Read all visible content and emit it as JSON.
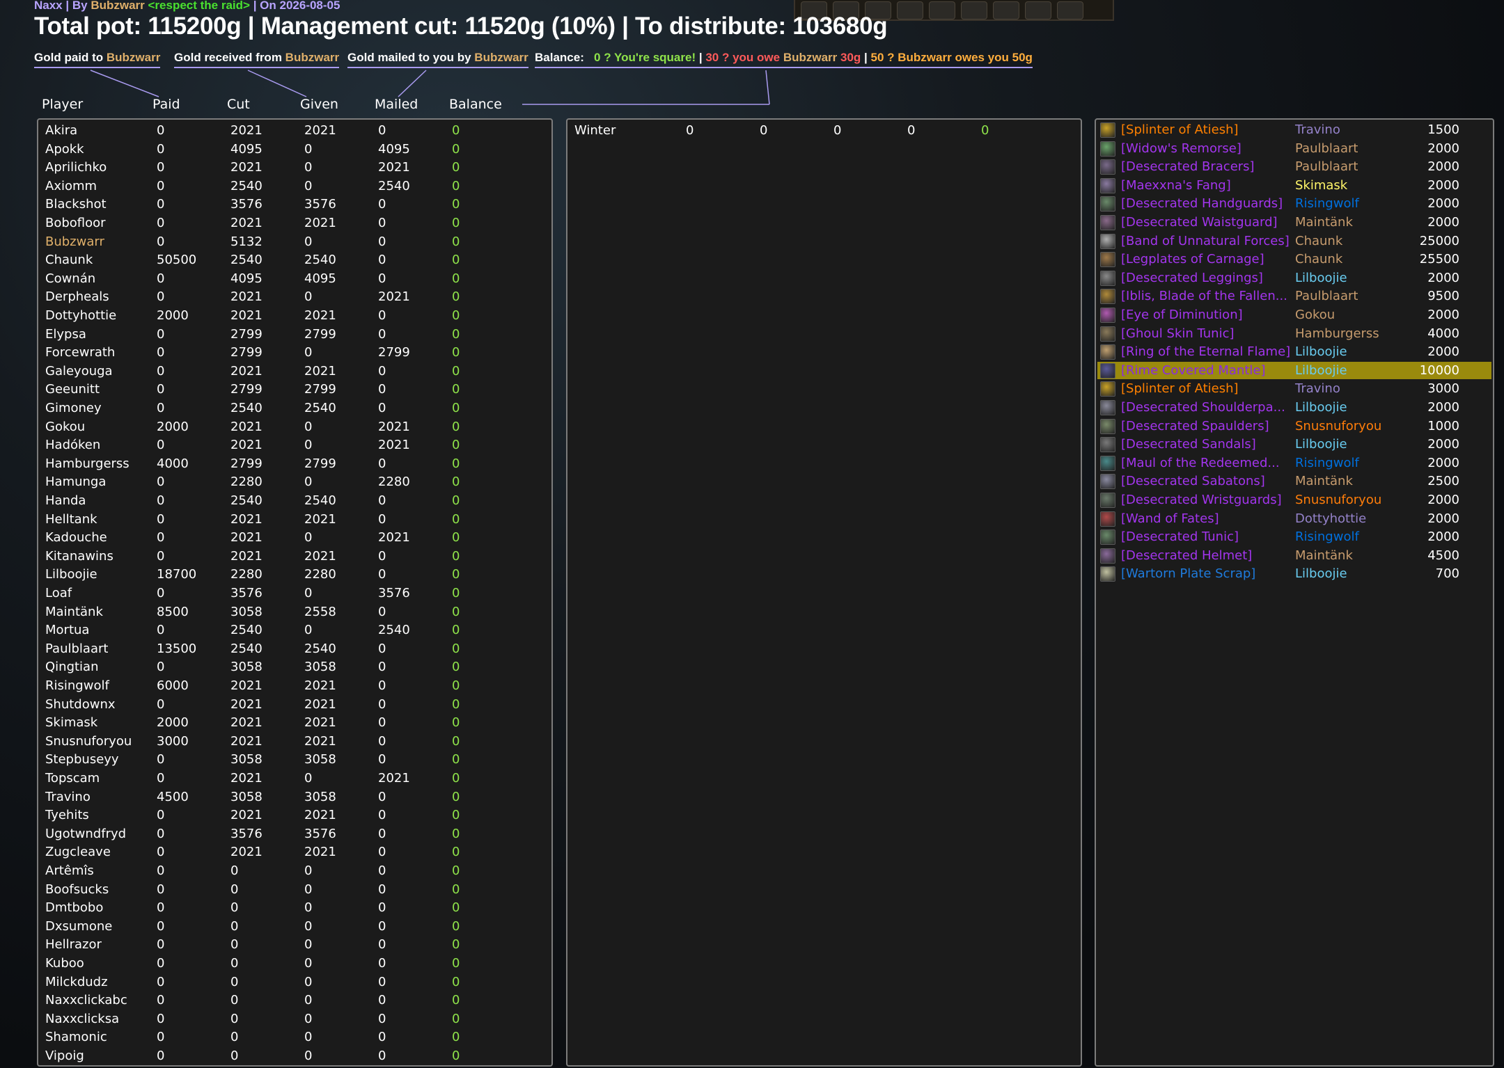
{
  "raid_info": {
    "raid": "Naxx",
    "sep1": " | By ",
    "leader": "Bubzwarr",
    "guild": " <respect the raid>",
    "date_text": " | On 2026-08-05"
  },
  "headline": "Total pot: 115200g | Management cut: 11520g (10%) | To distribute: 103680g",
  "legend": {
    "paid_prefix": "Gold paid to ",
    "paid_name": "Bubzwarr",
    "received_prefix": "Gold received from ",
    "received_name": "Bubzwarr",
    "mailed_prefix": "Gold mailed to you by ",
    "mailed_name": "Bubzwarr",
    "balance_label": "Balance:",
    "balance_square": "0 ? You're square!",
    "sep": " | ",
    "balance_owe_text": "30 ? you owe ",
    "balance_owe_name": "Bubzwarr",
    "balance_owe_amount": " 30g",
    "balance_owes_text": "50 ? ",
    "balance_owes_name": "Bubzwarr",
    "balance_owes_rest": " owes you 50g"
  },
  "columns": {
    "player": "Player",
    "paid": "Paid",
    "cut": "Cut",
    "given": "Given",
    "mailed": "Mailed",
    "balance": "Balance"
  },
  "colors": {
    "balance_zero": "#8fe34a",
    "leader": "#e0b06a",
    "highlight_row": "#9a8a0d"
  },
  "players": [
    {
      "name": "Akira",
      "paid": "0",
      "cut": "2021",
      "given": "2021",
      "mailed": "0",
      "balance": "0"
    },
    {
      "name": "Apokk",
      "paid": "0",
      "cut": "4095",
      "given": "0",
      "mailed": "4095",
      "balance": "0"
    },
    {
      "name": "Aprilichko",
      "paid": "0",
      "cut": "2021",
      "given": "0",
      "mailed": "2021",
      "balance": "0"
    },
    {
      "name": "Axiomm",
      "paid": "0",
      "cut": "2540",
      "given": "0",
      "mailed": "2540",
      "balance": "0"
    },
    {
      "name": "Blackshot",
      "paid": "0",
      "cut": "3576",
      "given": "3576",
      "mailed": "0",
      "balance": "0"
    },
    {
      "name": "Bobofloor",
      "paid": "0",
      "cut": "2021",
      "given": "2021",
      "mailed": "0",
      "balance": "0"
    },
    {
      "name": "Bubzwarr",
      "paid": "0",
      "cut": "5132",
      "given": "0",
      "mailed": "0",
      "balance": "0",
      "leader": true
    },
    {
      "name": "Chaunk",
      "paid": "50500",
      "cut": "2540",
      "given": "2540",
      "mailed": "0",
      "balance": "0"
    },
    {
      "name": "Cownán",
      "paid": "0",
      "cut": "4095",
      "given": "4095",
      "mailed": "0",
      "balance": "0"
    },
    {
      "name": "Derpheals",
      "paid": "0",
      "cut": "2021",
      "given": "0",
      "mailed": "2021",
      "balance": "0"
    },
    {
      "name": "Dottyhottie",
      "paid": "2000",
      "cut": "2021",
      "given": "2021",
      "mailed": "0",
      "balance": "0"
    },
    {
      "name": "Elypsa",
      "paid": "0",
      "cut": "2799",
      "given": "2799",
      "mailed": "0",
      "balance": "0"
    },
    {
      "name": "Forcewrath",
      "paid": "0",
      "cut": "2799",
      "given": "0",
      "mailed": "2799",
      "balance": "0"
    },
    {
      "name": "Galeyouga",
      "paid": "0",
      "cut": "2021",
      "given": "2021",
      "mailed": "0",
      "balance": "0"
    },
    {
      "name": "Geeunitt",
      "paid": "0",
      "cut": "2799",
      "given": "2799",
      "mailed": "0",
      "balance": "0"
    },
    {
      "name": "Gimoney",
      "paid": "0",
      "cut": "2540",
      "given": "2540",
      "mailed": "0",
      "balance": "0"
    },
    {
      "name": "Gokou",
      "paid": "2000",
      "cut": "2021",
      "given": "0",
      "mailed": "2021",
      "balance": "0"
    },
    {
      "name": "Hadóken",
      "paid": "0",
      "cut": "2021",
      "given": "0",
      "mailed": "2021",
      "balance": "0"
    },
    {
      "name": "Hamburgerss",
      "paid": "4000",
      "cut": "2799",
      "given": "2799",
      "mailed": "0",
      "balance": "0"
    },
    {
      "name": "Hamunga",
      "paid": "0",
      "cut": "2280",
      "given": "0",
      "mailed": "2280",
      "balance": "0"
    },
    {
      "name": "Handa",
      "paid": "0",
      "cut": "2540",
      "given": "2540",
      "mailed": "0",
      "balance": "0"
    },
    {
      "name": "Helltank",
      "paid": "0",
      "cut": "2021",
      "given": "2021",
      "mailed": "0",
      "balance": "0"
    },
    {
      "name": "Kadouche",
      "paid": "0",
      "cut": "2021",
      "given": "0",
      "mailed": "2021",
      "balance": "0"
    },
    {
      "name": "Kitanawins",
      "paid": "0",
      "cut": "2021",
      "given": "2021",
      "mailed": "0",
      "balance": "0"
    },
    {
      "name": "Lilboojie",
      "paid": "18700",
      "cut": "2280",
      "given": "2280",
      "mailed": "0",
      "balance": "0"
    },
    {
      "name": "Loaf",
      "paid": "0",
      "cut": "3576",
      "given": "0",
      "mailed": "3576",
      "balance": "0"
    },
    {
      "name": "Maintänk",
      "paid": "8500",
      "cut": "3058",
      "given": "2558",
      "mailed": "0",
      "balance": "0"
    },
    {
      "name": "Mortua",
      "paid": "0",
      "cut": "2540",
      "given": "0",
      "mailed": "2540",
      "balance": "0"
    },
    {
      "name": "Paulblaart",
      "paid": "13500",
      "cut": "2540",
      "given": "2540",
      "mailed": "0",
      "balance": "0"
    },
    {
      "name": "Qingtian",
      "paid": "0",
      "cut": "3058",
      "given": "3058",
      "mailed": "0",
      "balance": "0"
    },
    {
      "name": "Risingwolf",
      "paid": "6000",
      "cut": "2021",
      "given": "2021",
      "mailed": "0",
      "balance": "0"
    },
    {
      "name": "Shutdownx",
      "paid": "0",
      "cut": "2021",
      "given": "2021",
      "mailed": "0",
      "balance": "0"
    },
    {
      "name": "Skimask",
      "paid": "2000",
      "cut": "2021",
      "given": "2021",
      "mailed": "0",
      "balance": "0"
    },
    {
      "name": "Snusnuforyou",
      "paid": "3000",
      "cut": "2021",
      "given": "2021",
      "mailed": "0",
      "balance": "0"
    },
    {
      "name": "Stepbuseyy",
      "paid": "0",
      "cut": "3058",
      "given": "3058",
      "mailed": "0",
      "balance": "0"
    },
    {
      "name": "Topscam",
      "paid": "0",
      "cut": "2021",
      "given": "0",
      "mailed": "2021",
      "balance": "0"
    },
    {
      "name": "Travino",
      "paid": "4500",
      "cut": "3058",
      "given": "3058",
      "mailed": "0",
      "balance": "0"
    },
    {
      "name": "Tyehits",
      "paid": "0",
      "cut": "2021",
      "given": "2021",
      "mailed": "0",
      "balance": "0"
    },
    {
      "name": "Ugotwndfryd",
      "paid": "0",
      "cut": "3576",
      "given": "3576",
      "mailed": "0",
      "balance": "0"
    },
    {
      "name": "Zugcleave",
      "paid": "0",
      "cut": "2021",
      "given": "2021",
      "mailed": "0",
      "balance": "0"
    },
    {
      "name": "Artêmîs",
      "paid": "0",
      "cut": "0",
      "given": "0",
      "mailed": "0",
      "balance": "0"
    },
    {
      "name": "Boofsucks",
      "paid": "0",
      "cut": "0",
      "given": "0",
      "mailed": "0",
      "balance": "0"
    },
    {
      "name": "Dmtbobo",
      "paid": "0",
      "cut": "0",
      "given": "0",
      "mailed": "0",
      "balance": "0"
    },
    {
      "name": "Dxsumone",
      "paid": "0",
      "cut": "0",
      "given": "0",
      "mailed": "0",
      "balance": "0"
    },
    {
      "name": "Hellrazor",
      "paid": "0",
      "cut": "0",
      "given": "0",
      "mailed": "0",
      "balance": "0"
    },
    {
      "name": "Kuboo",
      "paid": "0",
      "cut": "0",
      "given": "0",
      "mailed": "0",
      "balance": "0"
    },
    {
      "name": "Milckdudz",
      "paid": "0",
      "cut": "0",
      "given": "0",
      "mailed": "0",
      "balance": "0"
    },
    {
      "name": "Naxxclickabc",
      "paid": "0",
      "cut": "0",
      "given": "0",
      "mailed": "0",
      "balance": "0"
    },
    {
      "name": "Naxxclicksa",
      "paid": "0",
      "cut": "0",
      "given": "0",
      "mailed": "0",
      "balance": "0"
    },
    {
      "name": "Shamonic",
      "paid": "0",
      "cut": "0",
      "given": "0",
      "mailed": "0",
      "balance": "0"
    },
    {
      "name": "Vipoig",
      "paid": "0",
      "cut": "0",
      "given": "0",
      "mailed": "0",
      "balance": "0"
    }
  ],
  "players2": [
    {
      "name": "Winter",
      "paid": "0",
      "cut": "0",
      "given": "0",
      "mailed": "0",
      "balance": "0"
    }
  ],
  "loot": [
    {
      "item": "[Splinter of Atiesh]",
      "quality": "q-leg",
      "icon_color": "#c9a227",
      "looter": "Travino",
      "class": "c-warlock",
      "amount": "1500"
    },
    {
      "item": "[Widow's Remorse]",
      "quality": "q-epic",
      "icon_color": "#6aa36a",
      "looter": "Paulblaart",
      "class": "c-warrior",
      "amount": "2000"
    },
    {
      "item": "[Desecrated Bracers]",
      "quality": "q-epic",
      "icon_color": "#7a6a8a",
      "looter": "Paulblaart",
      "class": "c-warrior",
      "amount": "2000"
    },
    {
      "item": "[Maexxna's Fang]",
      "quality": "q-epic",
      "icon_color": "#8a7aa0",
      "looter": "Skimask",
      "class": "c-rogue",
      "amount": "2000"
    },
    {
      "item": "[Desecrated Handguards]",
      "quality": "q-epic",
      "icon_color": "#6a8a6a",
      "looter": "Risingwolf",
      "class": "c-shaman",
      "amount": "2000"
    },
    {
      "item": "[Desecrated Waistguard]",
      "quality": "q-epic",
      "icon_color": "#8a6a8a",
      "looter": "Maintänk",
      "class": "c-warrior",
      "amount": "2000"
    },
    {
      "item": "[Band of Unnatural Forces]",
      "quality": "q-epic",
      "icon_color": "#b0b0b0",
      "looter": "Chaunk",
      "class": "c-warrior",
      "amount": "25000"
    },
    {
      "item": "[Legplates of Carnage]",
      "quality": "q-epic",
      "icon_color": "#a07a4a",
      "looter": "Chaunk",
      "class": "c-warrior",
      "amount": "25500"
    },
    {
      "item": "[Desecrated Leggings]",
      "quality": "q-epic",
      "icon_color": "#8a8a8a",
      "looter": "Lilboojie",
      "class": "c-mage",
      "amount": "2000"
    },
    {
      "item": "[Iblis, Blade of the Fallen...",
      "quality": "q-epic",
      "icon_color": "#b08a3a",
      "looter": "Paulblaart",
      "class": "c-warrior",
      "amount": "9500"
    },
    {
      "item": "[Eye of Diminution]",
      "quality": "q-epic",
      "icon_color": "#b05ab0",
      "looter": "Gokou",
      "class": "c-warrior",
      "amount": "2000"
    },
    {
      "item": "[Ghoul Skin Tunic]",
      "quality": "q-epic",
      "icon_color": "#8a7a5a",
      "looter": "Hamburgerss",
      "class": "c-warrior",
      "amount": "4000"
    },
    {
      "item": "[Ring of the Eternal Flame]",
      "quality": "q-epic",
      "icon_color": "#c0a070",
      "looter": "Lilboojie",
      "class": "c-mage",
      "amount": "2000"
    },
    {
      "item": "[Rime Covered Mantle]",
      "quality": "q-epic",
      "icon_color": "#5a5a9a",
      "looter": "Lilboojie",
      "class": "c-mage",
      "amount": "10000",
      "highlight": true
    },
    {
      "item": "[Splinter of Atiesh]",
      "quality": "q-leg",
      "icon_color": "#c9a227",
      "looter": "Travino",
      "class": "c-warlock",
      "amount": "3000"
    },
    {
      "item": "[Desecrated Shoulderpa...",
      "quality": "q-epic",
      "icon_color": "#8a8a9a",
      "looter": "Lilboojie",
      "class": "c-mage",
      "amount": "2000"
    },
    {
      "item": "[Desecrated Spaulders]",
      "quality": "q-epic",
      "icon_color": "#7a8a6a",
      "looter": "Snusnuforyou",
      "class": "c-druid",
      "amount": "1000"
    },
    {
      "item": "[Desecrated Sandals]",
      "quality": "q-epic",
      "icon_color": "#7a7a7a",
      "looter": "Lilboojie",
      "class": "c-mage",
      "amount": "2000"
    },
    {
      "item": "[Maul of the Redeemed...",
      "quality": "q-epic",
      "icon_color": "#4a8a8a",
      "looter": "Risingwolf",
      "class": "c-shaman",
      "amount": "2000"
    },
    {
      "item": "[Desecrated Sabatons]",
      "quality": "q-epic",
      "icon_color": "#8a8aa0",
      "looter": "Maintänk",
      "class": "c-warrior",
      "amount": "2500"
    },
    {
      "item": "[Desecrated Wristguards]",
      "quality": "q-epic",
      "icon_color": "#6a7a6a",
      "looter": "Snusnuforyou",
      "class": "c-druid",
      "amount": "2000"
    },
    {
      "item": "[Wand of Fates]",
      "quality": "q-epic",
      "icon_color": "#b04a4a",
      "looter": "Dottyhottie",
      "class": "c-warlock",
      "amount": "2000"
    },
    {
      "item": "[Desecrated Tunic]",
      "quality": "q-epic",
      "icon_color": "#6a8a6a",
      "looter": "Risingwolf",
      "class": "c-shaman",
      "amount": "2000"
    },
    {
      "item": "[Desecrated Helmet]",
      "quality": "q-epic",
      "icon_color": "#8a6a9a",
      "looter": "Maintänk",
      "class": "c-warrior",
      "amount": "4500"
    },
    {
      "item": "[Wartorn Plate Scrap]",
      "quality": "q-rare",
      "icon_color": "#c0c0a0",
      "looter": "Lilboojie",
      "class": "c-mage",
      "amount": "700"
    }
  ]
}
